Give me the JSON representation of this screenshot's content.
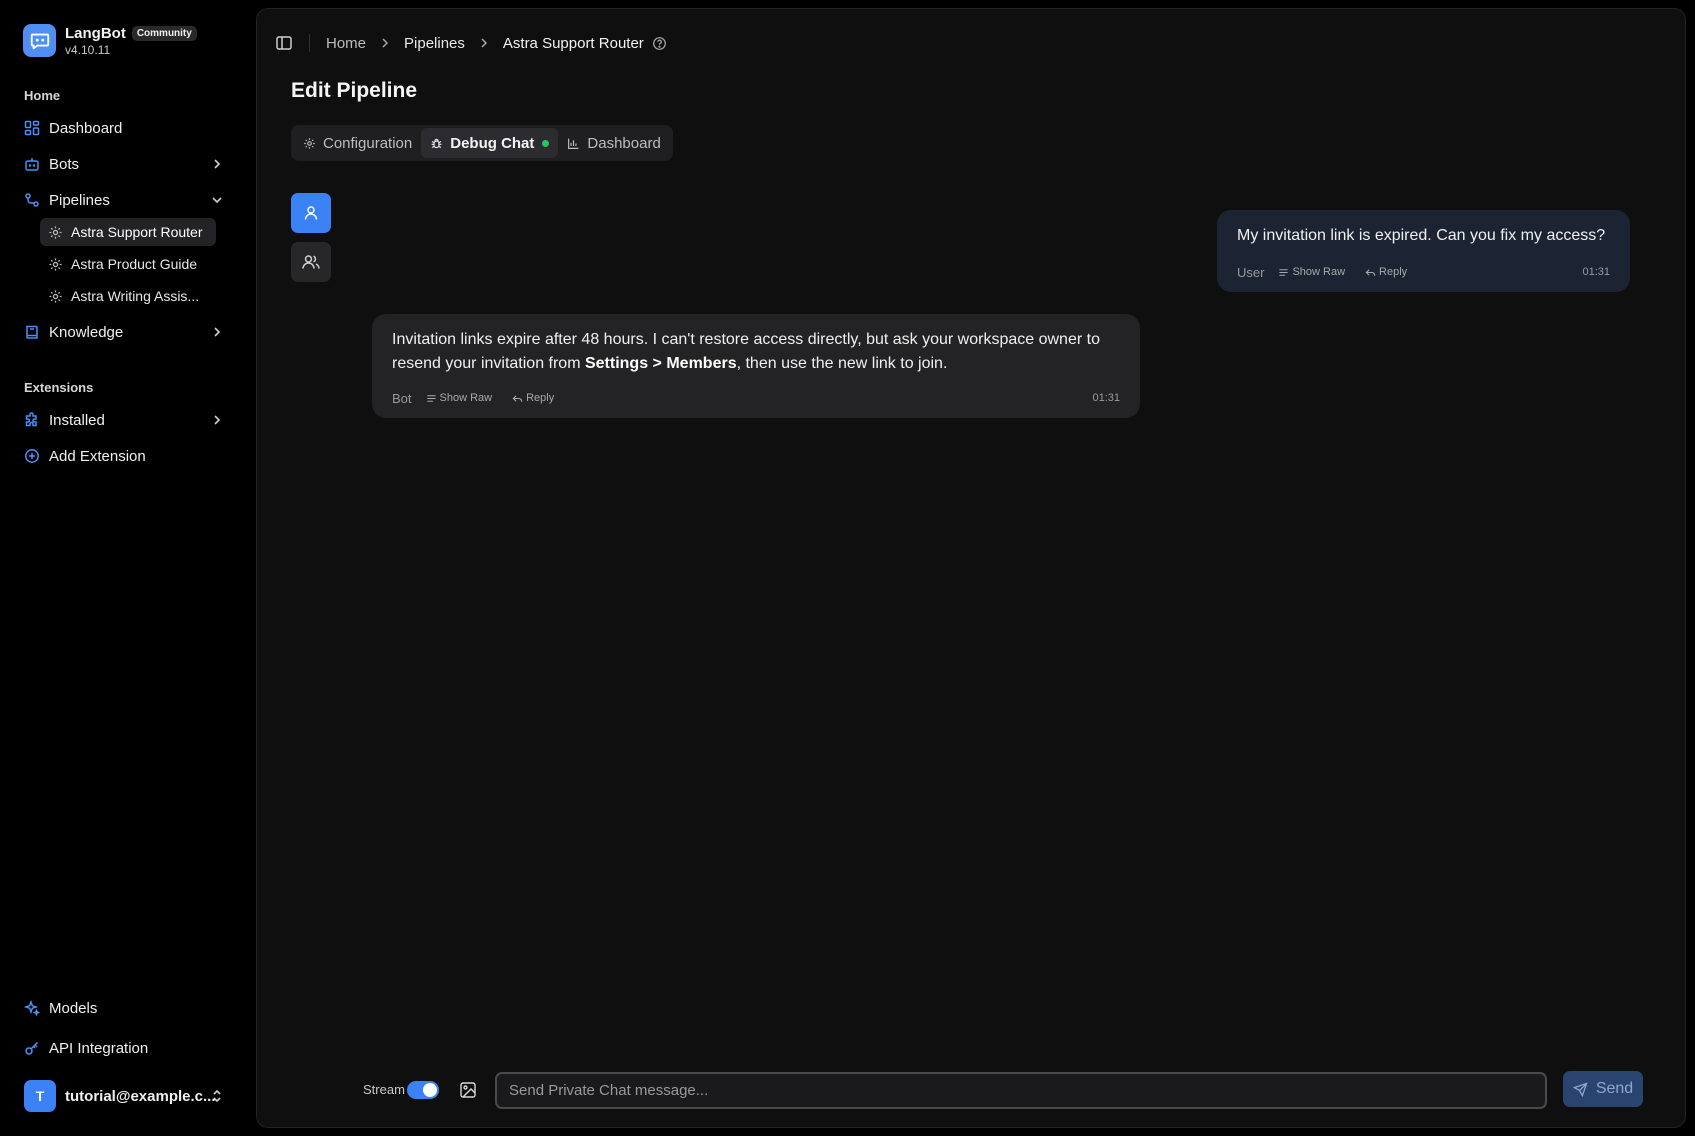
{
  "brand": {
    "name": "LangBot",
    "badge": "Community",
    "version": "v4.10.11"
  },
  "sidebar": {
    "home_label": "Home",
    "nav": [
      {
        "label": "Dashboard",
        "icon": "dashboard-icon"
      },
      {
        "label": "Bots",
        "icon": "bot-icon"
      },
      {
        "label": "Pipelines",
        "icon": "pipeline-icon"
      }
    ],
    "pipelines": [
      {
        "label": "Astra Support Router",
        "active": true
      },
      {
        "label": "Astra Product Guide",
        "active": false
      },
      {
        "label": "Astra Writing Assis...",
        "active": false
      }
    ],
    "knowledge_label": "Knowledge",
    "extensions_label": "Extensions",
    "installed_label": "Installed",
    "add_extension_label": "Add Extension",
    "models_label": "Models",
    "api_label": "API Integration",
    "user": {
      "initial": "T",
      "email": "tutorial@example.c..."
    }
  },
  "breadcrumb": {
    "home": "Home",
    "pipelines": "Pipelines",
    "current": "Astra Support Router"
  },
  "page_title": "Edit Pipeline",
  "tabs": {
    "configuration": "Configuration",
    "debug_chat": "Debug Chat",
    "dashboard": "Dashboard"
  },
  "messages": {
    "user": {
      "text": "My invitation link is expired. Can you fix my access?",
      "role": "User",
      "show_raw": "Show Raw",
      "reply": "Reply",
      "time": "01:31"
    },
    "bot": {
      "text_before": "Invitation links expire after 48 hours. I can't restore access directly, but ask your workspace owner to resend your invitation from ",
      "text_bold": "Settings > Members",
      "text_after": ", then use the new link to join.",
      "role": "Bot",
      "show_raw": "Show Raw",
      "reply": "Reply",
      "time": "01:31"
    }
  },
  "composer": {
    "stream_label": "Stream",
    "stream_on": true,
    "placeholder": "Send Private Chat message...",
    "send_label": "Send"
  },
  "colors": {
    "accent": "#3b82f6",
    "status_online": "#22c55e",
    "background": "#0f0f10"
  }
}
